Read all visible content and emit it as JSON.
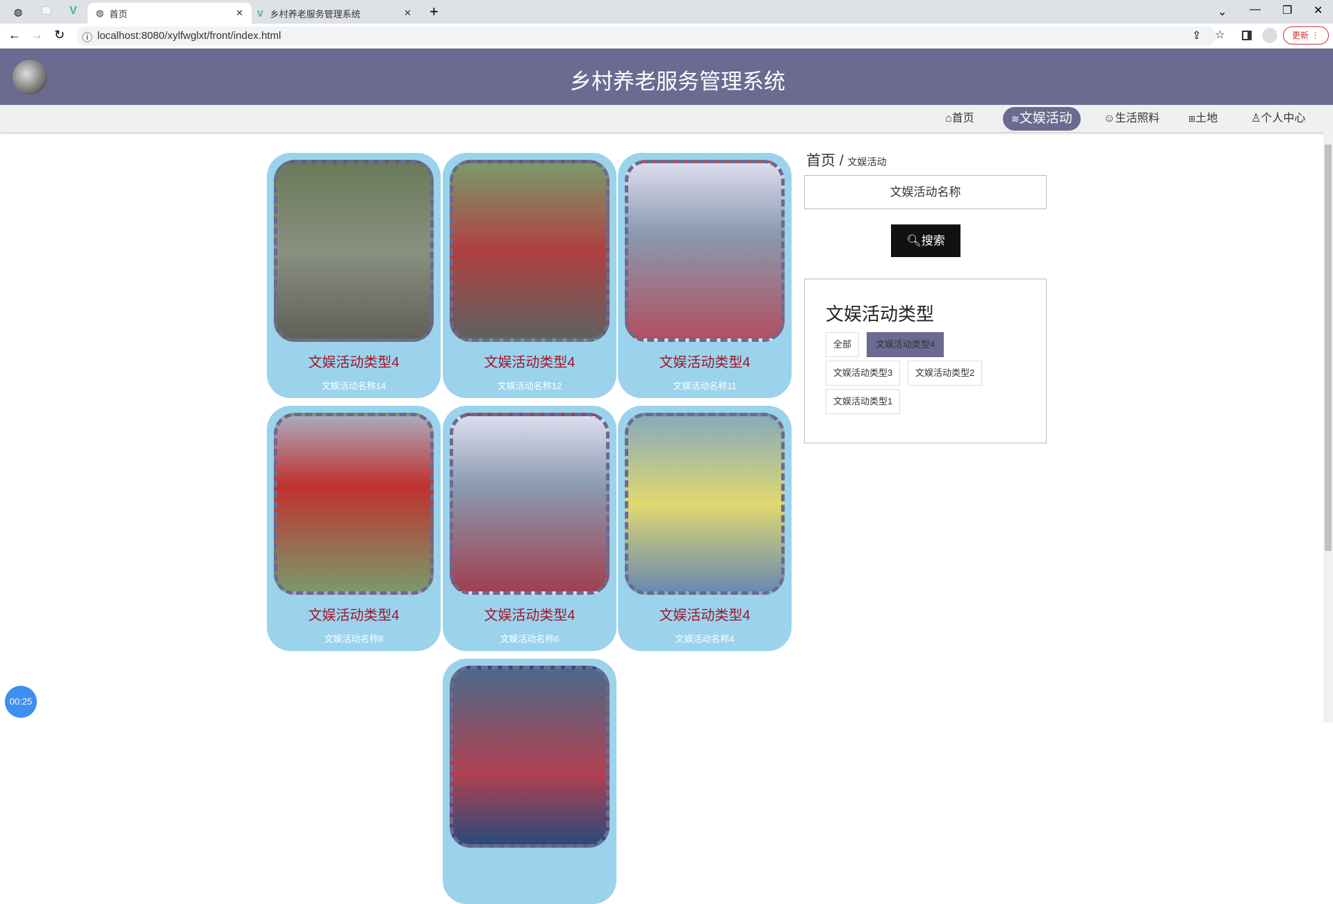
{
  "browser": {
    "tabs": [
      {
        "title": "首页"
      },
      {
        "title": "乡村养老服务管理系统"
      }
    ],
    "url": "localhost:8080/xylfwglxt/front/index.html",
    "update_label": "更新"
  },
  "header": {
    "title": "乡村养老服务管理系统"
  },
  "nav": [
    {
      "label": "首页",
      "icon": "home-icon"
    },
    {
      "label": "文娱活动",
      "icon": "layers-icon"
    },
    {
      "label": "生活照料",
      "icon": "palette-icon"
    },
    {
      "label": "土地",
      "icon": "gift-icon"
    },
    {
      "label": "个人中心",
      "icon": "user-icon"
    }
  ],
  "cards": [
    {
      "type": "文娱活动类型4",
      "name": "文娱活动名称14"
    },
    {
      "type": "文娱活动类型4",
      "name": "文娱活动名称12"
    },
    {
      "type": "文娱活动类型4",
      "name": "文娱活动名称11"
    },
    {
      "type": "文娱活动类型4",
      "name": "文娱活动名称8"
    },
    {
      "type": "文娱活动类型4",
      "name": "文娱活动名称6"
    },
    {
      "type": "文娱活动类型4",
      "name": "文娱活动名称4"
    }
  ],
  "breadcrumb": {
    "home": "首页",
    "sep": "/",
    "current": "文娱活动"
  },
  "search": {
    "placeholder": "文娱活动名称",
    "button": "搜索"
  },
  "types": {
    "title": "文娱活动类型",
    "items": [
      "全部",
      "文娱活动类型4",
      "文娱活动类型3",
      "文娱活动类型2",
      "文娱活动类型1"
    ],
    "active": "文娱活动类型4"
  },
  "timer": "00:25",
  "colors": {
    "primary": "#6b6a91",
    "card": "#9bd3ec",
    "card_title": "#a0142a"
  }
}
